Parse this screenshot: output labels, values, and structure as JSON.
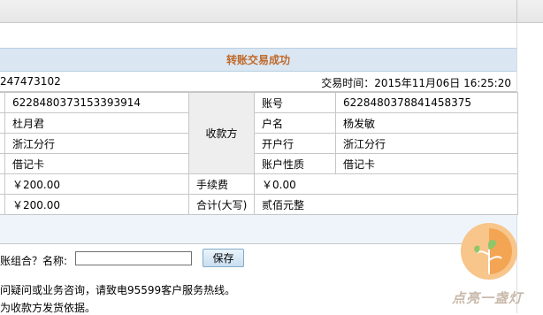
{
  "panel": {
    "title": "转账交易成功",
    "transaction_id": "247473102",
    "time_label": "交易时间：",
    "time_value": "2015年11月06日 16:25:20"
  },
  "payer": {
    "account": "6228480373153393914",
    "name": "杜月君",
    "branch": "浙江分行",
    "card_type": "借记卡"
  },
  "payee": {
    "section_label": "收款方",
    "account_label": "账号",
    "account": "6228480378841458375",
    "name_label": "户名",
    "name": "杨发敏",
    "branch_label": "开户行",
    "branch": "浙江分行",
    "card_type_label": "账户性质",
    "card_type": "借记卡"
  },
  "amounts": {
    "amount": "￥200.00",
    "fee_label": "手续费",
    "fee": "￥0.00",
    "total": "￥200.00",
    "total_label": "合计(大写)",
    "total_words": "贰佰元整"
  },
  "save_form": {
    "label": "账组合？名称:",
    "name_value": "",
    "save_label": "保存"
  },
  "notices": [
    "问疑问或业务咨询，请致电95599客户服务热线。",
    "为收款方发货依据。"
  ],
  "logo": {
    "text": "点亮一盏灯",
    "colors": {
      "bulb": "#f6b46a",
      "leaf": "#8fc66a",
      "text": "#c8b9aa"
    }
  },
  "colors": {
    "title_text": "#c0692a",
    "title_bg": "#dae7f3",
    "label_bg": "#eeeeee",
    "border": "#c7c7c7"
  }
}
